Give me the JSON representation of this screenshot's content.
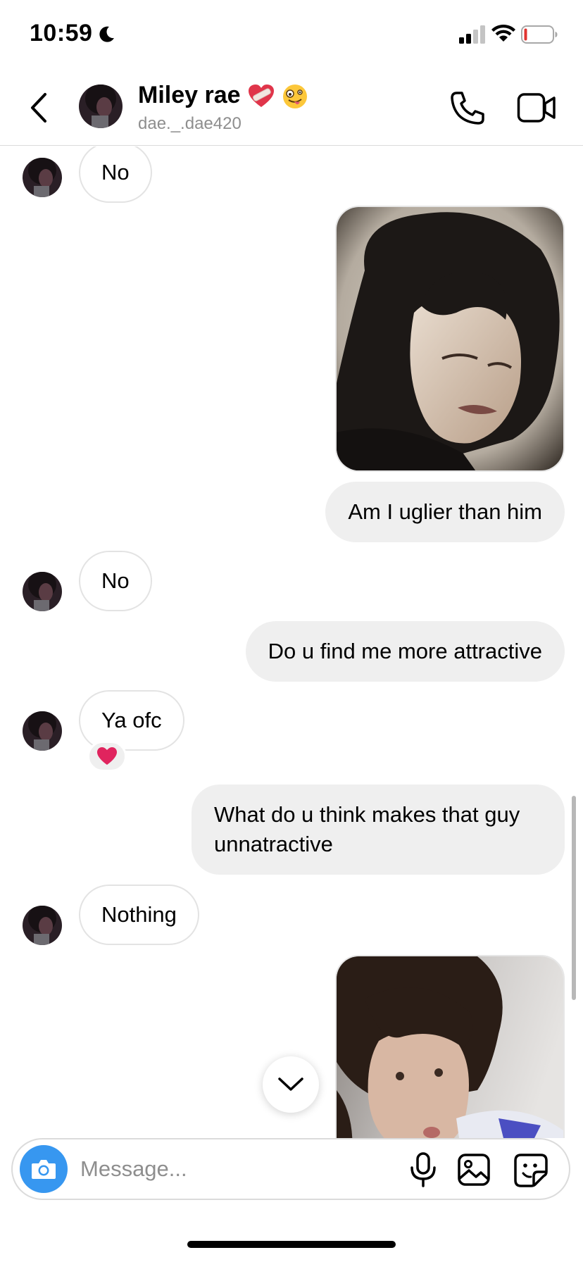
{
  "status_bar": {
    "time": "10:59"
  },
  "header": {
    "name": "Miley rae",
    "name_emojis": [
      "mending-heart",
      "zany-face"
    ],
    "username": "dae._.dae420"
  },
  "messages": [
    {
      "side": "in",
      "text": "No"
    },
    {
      "side": "out",
      "type": "photo",
      "subject": "curly dark-haired man portrait"
    },
    {
      "side": "out",
      "text": "Am I uglier than him"
    },
    {
      "side": "in",
      "text": "No"
    },
    {
      "side": "out",
      "text": "Do u find me more attractive"
    },
    {
      "side": "in",
      "text": "Ya ofc",
      "reaction": "red-heart"
    },
    {
      "side": "out",
      "text": "What do u think makes that guy unnatractive"
    },
    {
      "side": "in",
      "text": "Nothing"
    },
    {
      "side": "out",
      "type": "photo",
      "subject": "curly haired selfie"
    }
  ],
  "composer": {
    "placeholder": "Message..."
  },
  "colors": {
    "accent": "#3797f0",
    "bubble_out": "#efefef",
    "bubble_in_border": "#e3e3e3",
    "secondary_text": "#8e8e8e",
    "reaction_heart": "#e0245e",
    "battery_low": "#e0332f"
  }
}
